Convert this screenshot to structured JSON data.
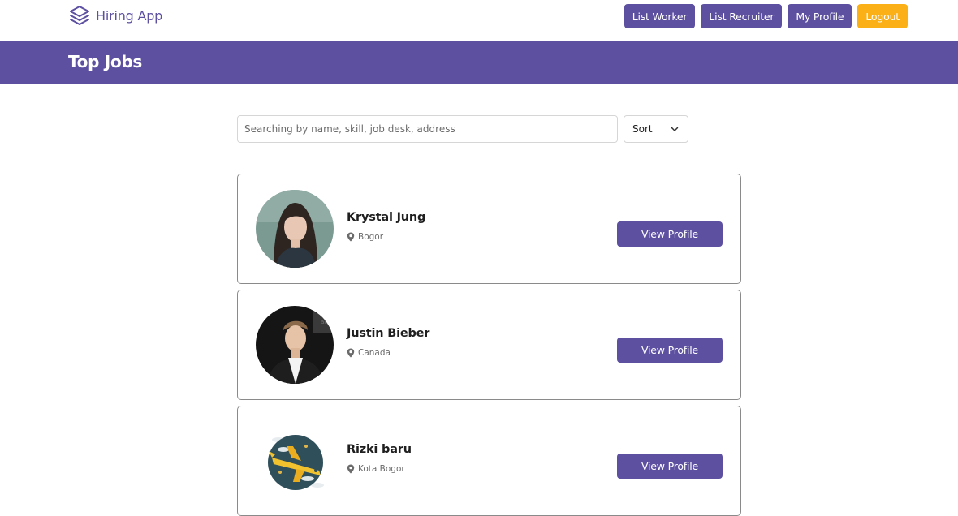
{
  "brand": {
    "name": "Hiring App",
    "icon": "layers-icon"
  },
  "nav": {
    "list_worker": "List Worker",
    "list_recruiter": "List Recruiter",
    "my_profile": "My Profile",
    "logout": "Logout"
  },
  "banner": {
    "title": "Top Jobs"
  },
  "search": {
    "placeholder": "Searching by name, skill, job desk, address",
    "value": ""
  },
  "sort": {
    "label": "Sort",
    "icon": "chevron-down-icon"
  },
  "workers": [
    {
      "name": "Krystal Jung",
      "location": "Bogor",
      "button": "View Profile",
      "avatar": "photo-woman"
    },
    {
      "name": "Justin Bieber",
      "location": "Canada",
      "button": "View Profile",
      "avatar": "photo-man"
    },
    {
      "name": "Rizki baru",
      "location": "Kota Bogor",
      "button": "View Profile",
      "avatar": "airplane-illustration"
    }
  ],
  "colors": {
    "primary": "#5e50a1",
    "accent": "#fbb017",
    "border": "#8a8a8a"
  }
}
